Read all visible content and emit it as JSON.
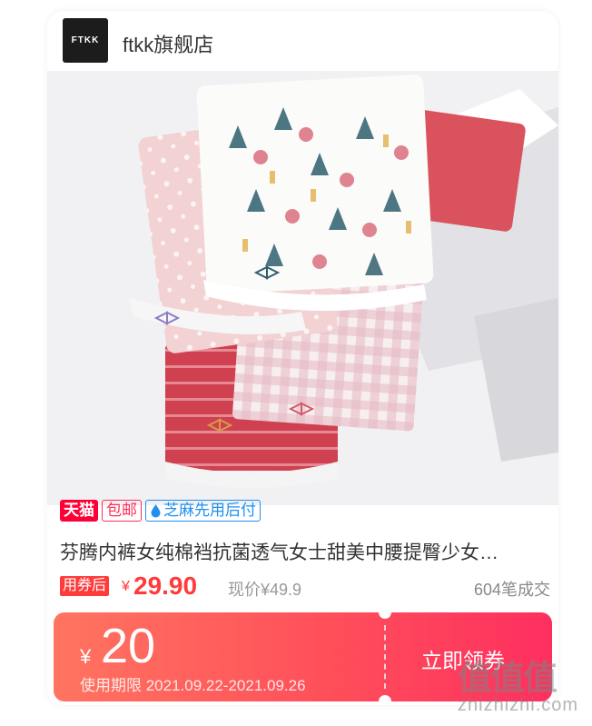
{
  "shop": {
    "logo_text": "FTKK",
    "name": "ftkk旗舰店"
  },
  "product": {
    "image_icon": "product-photo-kids-underwear",
    "tags": {
      "tmall": "天猫",
      "free_shipping": "包邮",
      "zhima": "芝麻先用后付"
    },
    "title": "芬腾内裤女纯棉裆抗菌透气女士甜美中腰提臀少女…",
    "coupon_price_label": "用券后",
    "currency": "¥",
    "price": "29.90",
    "original_price": "现价¥49.9",
    "sales": "604笔成交"
  },
  "coupon": {
    "currency": "¥",
    "amount": "20",
    "validity": "使用期限 2021.09.22-2021.09.26",
    "claim_label": "立即领券"
  },
  "watermark": {
    "logo": "值值值",
    "url": "zhizhizhi.com"
  },
  "colors": {
    "accent": "#ff3b3b",
    "tmall": "#ff0036",
    "zhima": "#1f8ff0"
  }
}
